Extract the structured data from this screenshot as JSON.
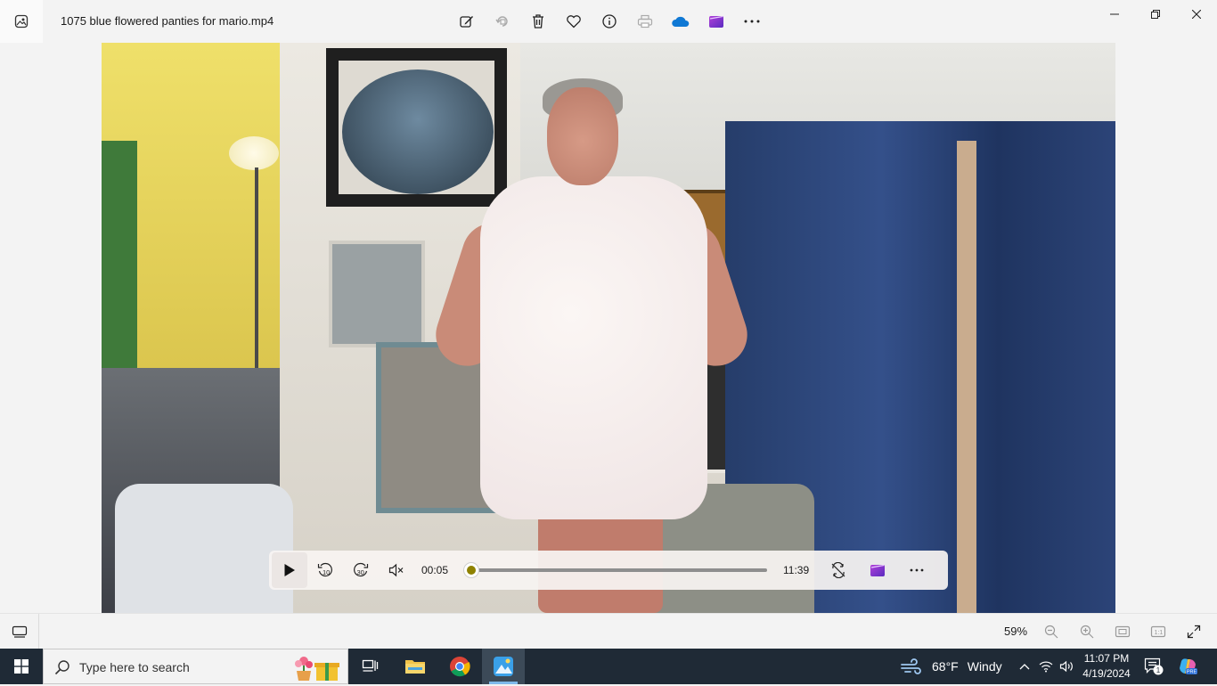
{
  "window": {
    "file_name": "1075 blue flowered panties for mario.mp4",
    "app_icon": "photos-app-icon"
  },
  "toolbar": {
    "items": [
      "edit-image-icon",
      "rotate-icon",
      "delete-icon",
      "favorite-icon",
      "info-icon",
      "print-icon",
      "onedrive-icon",
      "clipchamp-icon",
      "more-icon"
    ]
  },
  "window_controls": [
    "minimize-icon",
    "maximize-icon",
    "close-icon"
  ],
  "player": {
    "current_time": "00:05",
    "duration": "11:39",
    "progress": 0.007,
    "buttons": [
      "play-icon",
      "skip-back-10-icon",
      "skip-forward-30-icon",
      "mute-icon",
      "loop-icon",
      "clipchamp-icon",
      "more-icon"
    ]
  },
  "statusbar": {
    "zoom": "59%"
  },
  "taskbar": {
    "search_placeholder": "Type here to search",
    "weather_temp": "68°F",
    "weather_cond": "Windy",
    "time": "11:07 PM",
    "date": "4/19/2024",
    "notification_count": "1",
    "colors": {
      "taskbar_bg": "#1f2a36",
      "accent": "#7fb9ea"
    }
  }
}
